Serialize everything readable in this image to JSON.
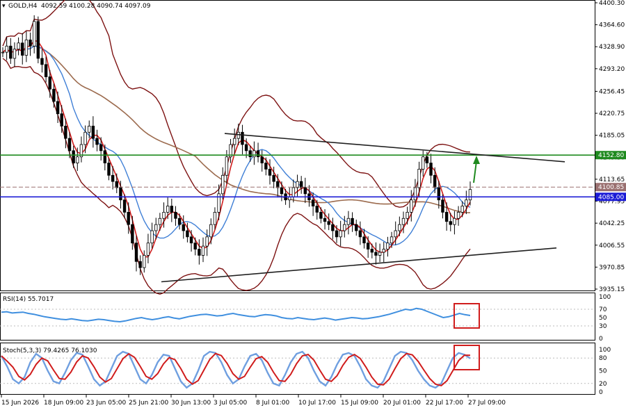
{
  "header": {
    "symbol": "GOLD,H4",
    "ohlc": "4092.59 4100.28 4090.74 4097.09"
  },
  "colors": {
    "background": "#ffffff",
    "frame": "#000000",
    "candle": "#000000",
    "ma_fast": "#d01c1c",
    "ma_mid": "#3f7fd6",
    "ma_slow": "#9c6b4e",
    "bands": "#7d1212",
    "support_line": "#1f1f1f",
    "resistance_line": "#1f1f1f",
    "green_level": "#1f8a1f",
    "blue_level": "#1c1cd6",
    "current_price_line": "#9a7070",
    "rsi_line": "#3f8fdf",
    "stoch_main": "#6f9fe0",
    "stoch_signal": "#d01c1c",
    "highlight_box": "#d01c1c",
    "arrow": "#1f8a1f"
  },
  "price_axis": {
    "ticks": [
      "4400.30",
      "4364.60",
      "4328.90",
      "4293.20",
      "4256.45",
      "4220.75",
      "4185.05",
      "4149.30",
      "4113.65",
      "4077.95",
      "4042.25",
      "4006.55",
      "3970.85",
      "3935.15"
    ],
    "tick_values": [
      4400.3,
      4364.6,
      4328.9,
      4293.2,
      4256.45,
      4220.75,
      4185.05,
      4149.3,
      4113.65,
      4077.95,
      4042.25,
      4006.55,
      3970.85,
      3935.15
    ],
    "price_tags": [
      {
        "label": "4152.80",
        "value": 4152.8,
        "color": "#1f8a1f"
      },
      {
        "label": "4100.85",
        "value": 4100.85,
        "color": "#9a7070"
      },
      {
        "label": "4085.00",
        "value": 4085.0,
        "color": "#1c1cd6"
      }
    ]
  },
  "time_axis": {
    "labels": [
      "15 Jun 2026",
      "18 Jun 09:00",
      "23 Jun 05:00",
      "25 Jun 21:00",
      "30 Jun 13:00",
      "3 Jul 05:00",
      "8 Jul 01:00",
      "10 Jul 17:00",
      "15 Jul 09:00",
      "20 Jul 01:00",
      "22 Jul 17:00",
      "27 Jul 09:00"
    ]
  },
  "rsi_panel": {
    "title": "RSI(14) 55.7017",
    "ticks": [
      "100",
      "70",
      "50",
      "30",
      "0"
    ],
    "tick_values": [
      100,
      70,
      50,
      30,
      0
    ]
  },
  "stoch_panel": {
    "title": "Stoch(5,3,3) 79.4265 76.1030",
    "ticks": [
      "100",
      "80",
      "50",
      "20",
      "0"
    ],
    "tick_values": [
      100,
      80,
      50,
      20,
      0
    ]
  },
  "chart_data": {
    "type": "line",
    "title": "GOLD,H4",
    "x_time_labels": [
      "15 Jun 2026",
      "18 Jun 09:00",
      "23 Jun 05:00",
      "25 Jun 21:00",
      "30 Jun 13:00",
      "3 Jul 05:00",
      "8 Jul 01:00",
      "10 Jul 17:00",
      "15 Jul 09:00",
      "20 Jul 01:00",
      "22 Jul 17:00",
      "27 Jul 09:00"
    ],
    "ylim": [
      3925,
      4405
    ],
    "close_series": [
      4320,
      4330,
      4310,
      4325,
      4335,
      4315,
      4340,
      4330,
      4370,
      4310,
      4300,
      4280,
      4260,
      4240,
      4220,
      4200,
      4180,
      4160,
      4140,
      4150,
      4170,
      4190,
      4200,
      4180,
      4170,
      4160,
      4140,
      4120,
      4110,
      4100,
      4080,
      4060,
      4040,
      4010,
      3980,
      3970,
      3990,
      4010,
      4030,
      4040,
      4050,
      4060,
      4070,
      4060,
      4050,
      4040,
      4030,
      4020,
      4010,
      4000,
      3990,
      4005,
      4020,
      4040,
      4060,
      4090,
      4120,
      4150,
      4170,
      4180,
      4190,
      4170,
      4160,
      4150,
      4160,
      4150,
      4140,
      4130,
      4120,
      4110,
      4100,
      4090,
      4080,
      4085,
      4100,
      4110,
      4100,
      4090,
      4080,
      4070,
      4060,
      4050,
      4045,
      4040,
      4030,
      4020,
      4030,
      4040,
      4050,
      4040,
      4030,
      4020,
      4010,
      4000,
      3995,
      3990,
      3995,
      4000,
      4010,
      4020,
      4030,
      4040,
      4050,
      4060,
      4080,
      4100,
      4130,
      4150,
      4140,
      4120,
      4100,
      4080,
      4060,
      4045,
      4040,
      4050,
      4060,
      4070,
      4080,
      4097
    ],
    "series": [
      {
        "name": "RSI(14)",
        "last": 55.7017
      },
      {
        "name": "Stoch(5,3,3)",
        "values": [
          79.4265,
          76.103
        ]
      }
    ],
    "horizontal_levels": [
      4152.8,
      4100.85,
      4085.0
    ],
    "trendlines": [
      {
        "kind": "resistance",
        "from": 4188,
        "to": 4142
      },
      {
        "kind": "support",
        "from": 3947,
        "to": 4002
      }
    ],
    "rsi_values": [
      63,
      64,
      61,
      62,
      63,
      60,
      58,
      55,
      52,
      50,
      48,
      46,
      45,
      47,
      45,
      43,
      42,
      44,
      46,
      45,
      43,
      41,
      40,
      42,
      45,
      48,
      50,
      47,
      45,
      47,
      50,
      52,
      49,
      47,
      50,
      53,
      55,
      57,
      58,
      56,
      54,
      55,
      58,
      60,
      57,
      55,
      53,
      52,
      55,
      57,
      56,
      54,
      50,
      48,
      47,
      50,
      48,
      46,
      45,
      47,
      49,
      47,
      44,
      46,
      48,
      50,
      49,
      47,
      48,
      50,
      52,
      55,
      58,
      62,
      66,
      70,
      68,
      72,
      70,
      65,
      60,
      55,
      50,
      52,
      56,
      60,
      57,
      55
    ],
    "stoch_values": [
      85,
      60,
      30,
      20,
      35,
      70,
      90,
      80,
      50,
      25,
      20,
      45,
      75,
      92,
      88,
      60,
      30,
      15,
      25,
      55,
      85,
      95,
      90,
      60,
      30,
      20,
      40,
      70,
      88,
      85,
      55,
      25,
      10,
      20,
      50,
      85,
      95,
      92,
      70,
      40,
      20,
      30,
      60,
      85,
      90,
      75,
      45,
      20,
      15,
      40,
      70,
      90,
      95,
      80,
      50,
      25,
      15,
      35,
      65,
      88,
      92,
      85,
      60,
      30,
      15,
      10,
      25,
      55,
      85,
      95,
      92,
      75,
      50,
      30,
      15,
      10,
      20,
      50,
      80,
      92,
      88,
      79
    ]
  }
}
